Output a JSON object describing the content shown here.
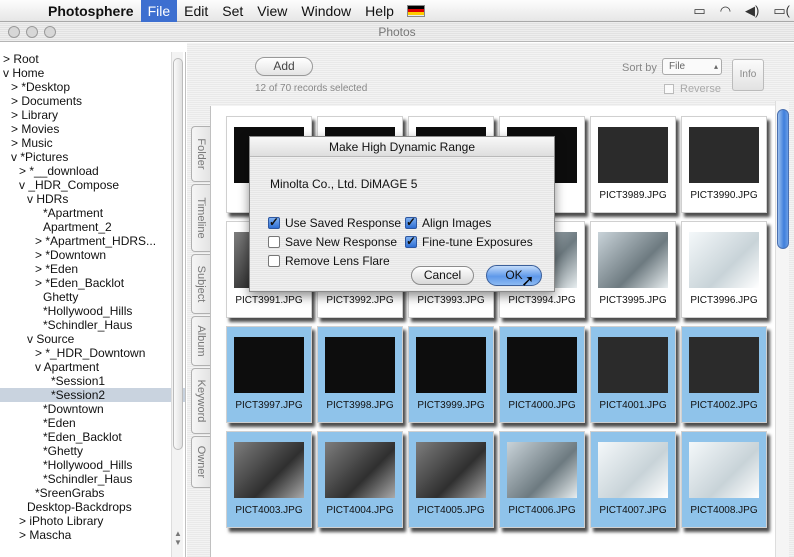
{
  "menubar": {
    "app": "Photosphere",
    "items": [
      "File",
      "Edit",
      "Set",
      "View",
      "Window",
      "Help"
    ],
    "active": "File",
    "status_icons": [
      "display-icon",
      "wifi-icon",
      "volume-icon",
      "battery-icon"
    ],
    "flag_colors": [
      "#000000",
      "#dd0000",
      "#ffcc00"
    ]
  },
  "window": {
    "title": "Photos"
  },
  "sidebar": {
    "items": [
      {
        "label": "> Root",
        "indent": 0
      },
      {
        "label": "v Home",
        "indent": 0
      },
      {
        "label": "> *Desktop",
        "indent": 1
      },
      {
        "label": "> Documents",
        "indent": 1
      },
      {
        "label": "> Library",
        "indent": 1
      },
      {
        "label": "> Movies",
        "indent": 1
      },
      {
        "label": "> Music",
        "indent": 1
      },
      {
        "label": "v *Pictures",
        "indent": 1
      },
      {
        "label": "> *__download",
        "indent": 2
      },
      {
        "label": "v _HDR_Compose",
        "indent": 2
      },
      {
        "label": "v HDRs",
        "indent": 3
      },
      {
        "label": "*Apartment",
        "indent": 5
      },
      {
        "label": "Apartment_2",
        "indent": 5
      },
      {
        "label": "> *Apartment_HDRS...",
        "indent": 4
      },
      {
        "label": "> *Downtown",
        "indent": 4
      },
      {
        "label": "> *Eden",
        "indent": 4
      },
      {
        "label": "> *Eden_Backlot",
        "indent": 4
      },
      {
        "label": "Ghetty",
        "indent": 5
      },
      {
        "label": "*Hollywood_Hills",
        "indent": 5
      },
      {
        "label": "*Schindler_Haus",
        "indent": 5
      },
      {
        "label": "v Source",
        "indent": 3
      },
      {
        "label": "> *_HDR_Downtown",
        "indent": 4
      },
      {
        "label": "v Apartment",
        "indent": 4
      },
      {
        "label": "*Session1",
        "indent": 6
      },
      {
        "label": "*Session2",
        "indent": 6,
        "selected": true
      },
      {
        "label": "*Downtown",
        "indent": 5
      },
      {
        "label": "*Eden",
        "indent": 5
      },
      {
        "label": "*Eden_Backlot",
        "indent": 5
      },
      {
        "label": "*Ghetty",
        "indent": 5
      },
      {
        "label": "*Hollywood_Hills",
        "indent": 5
      },
      {
        "label": "*Schindler_Haus",
        "indent": 5
      },
      {
        "label": "*SreenGrabs",
        "indent": 4
      },
      {
        "label": "Desktop-Backdrops",
        "indent": 3
      },
      {
        "label": "> iPhoto Library",
        "indent": 2
      },
      {
        "label": "> Mascha",
        "indent": 2
      }
    ]
  },
  "toolbar": {
    "add_label": "Add",
    "records_text": "12 of 70 records selected",
    "sort_by_label": "Sort by",
    "sort_value": "File",
    "reverse_label": "Reverse",
    "info_label": "Info"
  },
  "tabs": [
    "Folder",
    "Timeline",
    "Subject",
    "Album",
    "Keyword",
    "Owner"
  ],
  "thumbnails": [
    {
      "file": "",
      "selected": false,
      "tone": "dark"
    },
    {
      "file": "",
      "selected": false,
      "tone": "dark"
    },
    {
      "file": "",
      "selected": false,
      "tone": "dark"
    },
    {
      "file": "",
      "selected": false,
      "tone": "dark"
    },
    {
      "file": "PICT3989.JPG",
      "selected": false,
      "tone": "dim"
    },
    {
      "file": "PICT3990.JPG",
      "selected": false,
      "tone": "dim"
    },
    {
      "file": "PICT3991.JPG",
      "selected": false,
      "tone": "mid"
    },
    {
      "file": "PICT3992.JPG",
      "selected": false,
      "tone": "mid"
    },
    {
      "file": "PICT3993.JPG",
      "selected": false,
      "tone": "mid"
    },
    {
      "file": "PICT3994.JPG",
      "selected": false,
      "tone": "bright"
    },
    {
      "file": "PICT3995.JPG",
      "selected": false,
      "tone": "bright"
    },
    {
      "file": "PICT3996.JPG",
      "selected": false,
      "tone": "white"
    },
    {
      "file": "PICT3997.JPG",
      "selected": true,
      "tone": "dark"
    },
    {
      "file": "PICT3998.JPG",
      "selected": true,
      "tone": "dark"
    },
    {
      "file": "PICT3999.JPG",
      "selected": true,
      "tone": "dark"
    },
    {
      "file": "PICT4000.JPG",
      "selected": true,
      "tone": "dark"
    },
    {
      "file": "PICT4001.JPG",
      "selected": true,
      "tone": "dim"
    },
    {
      "file": "PICT4002.JPG",
      "selected": true,
      "tone": "dim"
    },
    {
      "file": "PICT4003.JPG",
      "selected": true,
      "tone": "mid"
    },
    {
      "file": "PICT4004.JPG",
      "selected": true,
      "tone": "mid"
    },
    {
      "file": "PICT4005.JPG",
      "selected": true,
      "tone": "mid"
    },
    {
      "file": "PICT4006.JPG",
      "selected": true,
      "tone": "bright"
    },
    {
      "file": "PICT4007.JPG",
      "selected": true,
      "tone": "white"
    },
    {
      "file": "PICT4008.JPG",
      "selected": true,
      "tone": "white"
    }
  ],
  "dialog": {
    "title": "Make High Dynamic Range",
    "camera": "Minolta Co., Ltd. DiMAGE 5",
    "options": {
      "use_saved_response": {
        "label": "Use Saved Response",
        "checked": true
      },
      "save_new_response": {
        "label": "Save New Response",
        "checked": false
      },
      "remove_lens_flare": {
        "label": "Remove Lens Flare",
        "checked": false
      },
      "align_images": {
        "label": "Align Images",
        "checked": true
      },
      "fine_tune": {
        "label": "Fine-tune Exposures",
        "checked": true
      }
    },
    "cancel_label": "Cancel",
    "ok_label": "OK"
  },
  "colors": {
    "selection": "#8fc3ea",
    "menu_highlight": "#3d6fd0",
    "tree_selected": "#c9d3df"
  }
}
